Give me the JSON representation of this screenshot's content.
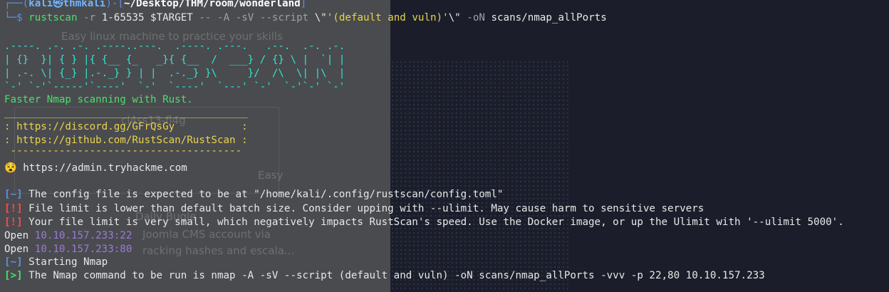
{
  "prompt": {
    "corner": "┌──(",
    "user": "kali",
    "at": "㉿",
    "host": "thmkali",
    "sep": ")-[",
    "path": "~/Desktop/THM/room/wonderland",
    "close": "]",
    "arrow": "└─$"
  },
  "command": {
    "bin": "rustscan",
    "flag_r": "-r",
    "range": "1-65535",
    "target": "$TARGET",
    "dashes": "--",
    "flags": "-A -sV --script",
    "esc1": "\\\"",
    "quote1": "'",
    "script_arg": "(default and vuln)",
    "quote2": "'",
    "esc2": "\\\"",
    "out_flag": "-oN",
    "out_file": "scans/nmap_allPorts"
  },
  "banner": {
    "ascii": [
      ".----. .-. .-. .----..---.  .----. .---.   .--.  .-. .-.",
      "| {}  }| { } |{ {__ {_   _}{ {__  /  ___} / {} \\ |  `| |",
      "| .-. \\| {_} |.-._} } | |  .-._} }\\     }/  /\\  \\| |\\  |",
      "`-' `-'`-----'`----'  `-'  `----'  `---' `-'  `-'`-' `-'"
    ],
    "tagline": "Faster Nmap scanning with Rust.",
    "rule_top": "________________________________________",
    "discord": ": https://discord.gg/GFrQsGy           :",
    "github": ": https://github.com/RustScan/RustScan :",
    "rule_bottom": " --------------------------------------"
  },
  "admin_line": {
    "icon": "😵",
    "text": " https://admin.tryhackme.com"
  },
  "messages": [
    {
      "tag": "[~]",
      "kind": "info",
      "text": " The config file is expected to be at \"/home/kali/.config/rustscan/config.toml\""
    },
    {
      "tag": "[!]",
      "kind": "warn",
      "text": " File limit is lower than default batch size. Consider upping with --ulimit. May cause harm to sensitive servers"
    },
    {
      "tag": "[!]",
      "kind": "warn",
      "text": " Your file limit is very small, which negatively impacts RustScan's speed. Use the Docker image, or up the Ulimit with '--ulimit 5000'."
    }
  ],
  "open_ports": [
    {
      "label": "Open",
      "addr": "10.10.157.233:22"
    },
    {
      "label": "Open",
      "addr": "10.10.157.233:80"
    }
  ],
  "starting": {
    "tag": "[~]",
    "text": " Starting Nmap"
  },
  "nmap_cmd": {
    "tag": "[>]",
    "text": " The Nmap command to be run is nmap -A -sV --script (default and vuln) -oN scans/nmap_allPorts -vvv -p 22,80 10.10.157.233"
  },
  "ghost": {
    "line1": "Easy linux machine to practice your skills",
    "line2": "cl4ss13-fl4g",
    "line3": "Easy",
    "line4": "Daily Bugle",
    "line5": "Joomla CMS account via",
    "line6": "racking hashes and escala..."
  },
  "colors": {
    "background": "#1b1e2a",
    "ascii": "#2ee6d2",
    "info_tag": "#5c8fe6",
    "warn_tag": "#ff4a4a",
    "ok_tag": "#49e06a",
    "address": "#9a7ad6"
  }
}
